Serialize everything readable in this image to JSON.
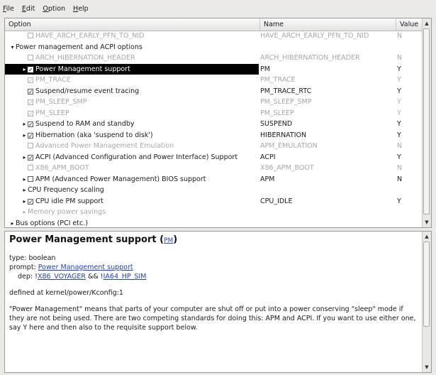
{
  "menu": [
    {
      "label": "File",
      "ul": "F",
      "rest": "ile"
    },
    {
      "label": "Edit",
      "ul": "E",
      "rest": "dit"
    },
    {
      "label": "Option",
      "ul": "O",
      "rest": "ption"
    },
    {
      "label": "Help",
      "ul": "H",
      "rest": "elp"
    }
  ],
  "columns": {
    "option": "Option",
    "name": "Name",
    "value": "Value"
  },
  "rows": [
    {
      "indent": 2,
      "arrow": "",
      "check": "empty",
      "option": "HAVE_ARCH_EARLY_PFN_TO_NID",
      "name": "HAVE_ARCH_EARLY_PFN_TO_NID",
      "value": "N",
      "dim": true
    },
    {
      "indent": 0,
      "arrow": "down",
      "check": "",
      "option": "Power management and ACPI options",
      "name": "",
      "value": "",
      "dim": false
    },
    {
      "indent": 2,
      "arrow": "",
      "check": "empty",
      "option": "ARCH_HIBERNATION_HEADER",
      "name": "ARCH_HIBERNATION_HEADER",
      "value": "N",
      "dim": true
    },
    {
      "indent": 1,
      "arrow": "right",
      "check": "checked",
      "option": "Power Management support",
      "name": "PM",
      "value": "Y",
      "dim": false,
      "selected": true
    },
    {
      "indent": 2,
      "arrow": "",
      "check": "checked",
      "option": "PM_TRACE",
      "name": "PM_TRACE",
      "value": "Y",
      "dim": true
    },
    {
      "indent": 2,
      "arrow": "",
      "check": "checked",
      "option": "Suspend/resume event tracing",
      "name": "PM_TRACE_RTC",
      "value": "Y",
      "dim": false
    },
    {
      "indent": 2,
      "arrow": "",
      "check": "checked",
      "option": "PM_SLEEP_SMP",
      "name": "PM_SLEEP_SMP",
      "value": "Y",
      "dim": true
    },
    {
      "indent": 2,
      "arrow": "",
      "check": "checked",
      "option": "PM_SLEEP",
      "name": "PM_SLEEP",
      "value": "Y",
      "dim": true
    },
    {
      "indent": 1,
      "arrow": "right",
      "check": "checked",
      "option": "Suspend to RAM and standby",
      "name": "SUSPEND",
      "value": "Y",
      "dim": false
    },
    {
      "indent": 1,
      "arrow": "right",
      "check": "checked",
      "option": "Hibernation (aka 'suspend to disk')",
      "name": "HIBERNATION",
      "value": "Y",
      "dim": false
    },
    {
      "indent": 2,
      "arrow": "",
      "check": "empty",
      "option": "Advanced Power Management Emulation",
      "name": "APM_EMULATION",
      "value": "N",
      "dim": true
    },
    {
      "indent": 1,
      "arrow": "right",
      "check": "checked",
      "option": "ACPI (Advanced Configuration and Power Interface) Support",
      "name": "ACPI",
      "value": "Y",
      "dim": false
    },
    {
      "indent": 2,
      "arrow": "",
      "check": "empty",
      "option": "X86_APM_BOOT",
      "name": "X86_APM_BOOT",
      "value": "N",
      "dim": true
    },
    {
      "indent": 1,
      "arrow": "right",
      "check": "empty",
      "option": "APM (Advanced Power Management) BIOS support",
      "name": "APM",
      "value": "N",
      "dim": false
    },
    {
      "indent": 1,
      "arrow": "right",
      "check": "",
      "option": "CPU Frequency scaling",
      "name": "",
      "value": "",
      "dim": false
    },
    {
      "indent": 1,
      "arrow": "right",
      "check": "checked",
      "option": "CPU idle PM support",
      "name": "CPU_IDLE",
      "value": "Y",
      "dim": false
    },
    {
      "indent": 1,
      "arrow": "right",
      "check": "",
      "option": "Memory power savings",
      "name": "",
      "value": "",
      "dim": true
    },
    {
      "indent": 0,
      "arrow": "right",
      "check": "",
      "option": "Bus options (PCI etc.)",
      "name": "",
      "value": "",
      "dim": false
    }
  ],
  "help": {
    "title": "Power Management support",
    "title_symbol": "PM",
    "type_line": "type: boolean",
    "prompt_label": "prompt: ",
    "prompt_link": "Power Management support",
    "dep_label": "dep: !",
    "dep_link1": "X86_VOYAGER",
    "dep_mid": " && !",
    "dep_link2": "IA64_HP_SIM",
    "defined": "defined at kernel/power/Kconfig:1",
    "description": "\"Power Management\" means that parts of your computer are shut off or put into a power conserving \"sleep\" mode if they are not being used. There are two competing standards for doing this: APM and ACPI. If you want to use either one, say Y here and then also to the requisite support below."
  }
}
